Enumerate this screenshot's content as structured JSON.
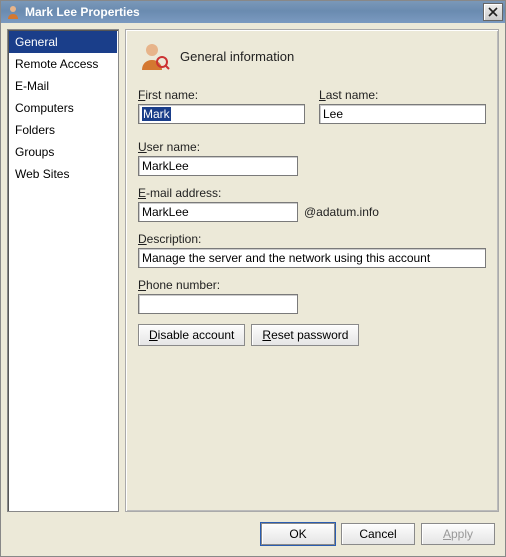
{
  "window": {
    "title": "Mark Lee Properties"
  },
  "sidebar": {
    "items": [
      {
        "label": "General",
        "selected": true
      },
      {
        "label": "Remote Access",
        "selected": false
      },
      {
        "label": "E-Mail",
        "selected": false
      },
      {
        "label": "Computers",
        "selected": false
      },
      {
        "label": "Folders",
        "selected": false
      },
      {
        "label": "Groups",
        "selected": false
      },
      {
        "label": "Web Sites",
        "selected": false
      }
    ]
  },
  "panel": {
    "title": "General information",
    "labels": {
      "first_name": "First name:",
      "last_name": "Last name:",
      "user_name": "User name:",
      "email": "E-mail address:",
      "description": "Description:",
      "phone": "Phone number:"
    },
    "values": {
      "first_name": "Mark",
      "last_name": "Lee",
      "user_name": "MarkLee",
      "email": "MarkLee",
      "email_domain": "@adatum.info",
      "description": "Manage the server and the network using this account",
      "phone": ""
    },
    "buttons": {
      "disable": "Disable account",
      "reset": "Reset password"
    }
  },
  "footer": {
    "ok": "OK",
    "cancel": "Cancel",
    "apply": "Apply"
  }
}
